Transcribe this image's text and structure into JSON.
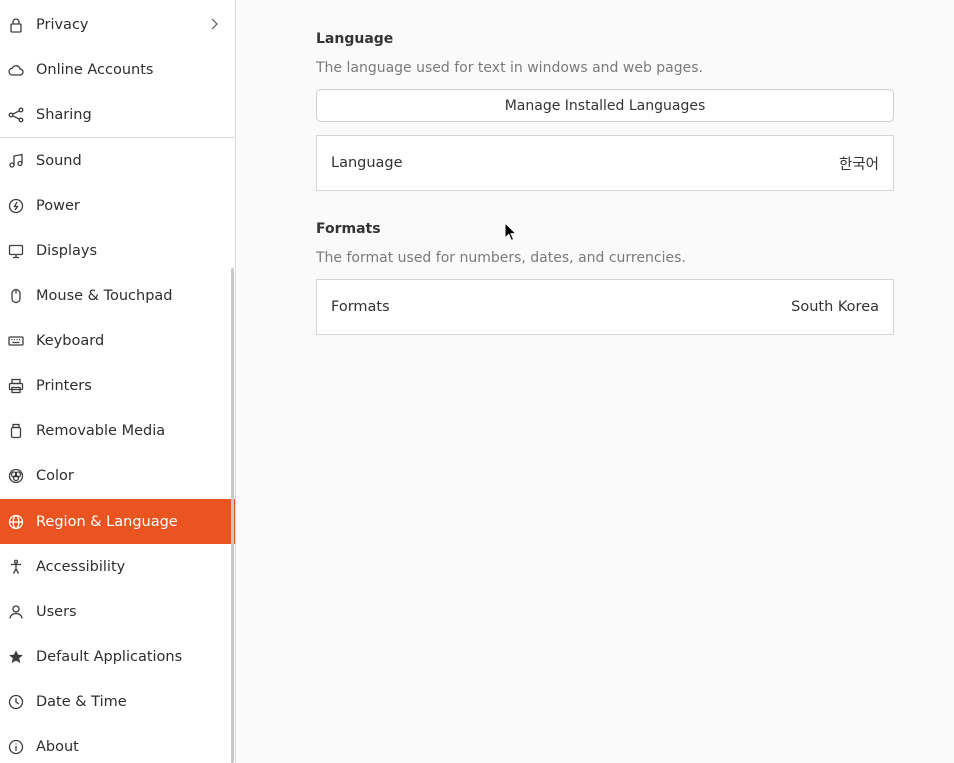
{
  "sidebar": {
    "items": [
      {
        "label": "Privacy",
        "icon": "lock-icon",
        "has_chevron": true
      },
      {
        "label": "Online Accounts",
        "icon": "cloud-icon"
      },
      {
        "label": "Sharing",
        "icon": "share-icon"
      },
      {
        "label": "Sound",
        "icon": "music-note-icon"
      },
      {
        "label": "Power",
        "icon": "power-icon"
      },
      {
        "label": "Displays",
        "icon": "display-icon"
      },
      {
        "label": "Mouse & Touchpad",
        "icon": "mouse-icon"
      },
      {
        "label": "Keyboard",
        "icon": "keyboard-icon"
      },
      {
        "label": "Printers",
        "icon": "printer-icon"
      },
      {
        "label": "Removable Media",
        "icon": "usb-drive-icon"
      },
      {
        "label": "Color",
        "icon": "color-icon"
      },
      {
        "label": "Region & Language",
        "icon": "globe-icon",
        "active": true
      },
      {
        "label": "Accessibility",
        "icon": "accessibility-icon"
      },
      {
        "label": "Users",
        "icon": "user-icon"
      },
      {
        "label": "Default Applications",
        "icon": "star-icon"
      },
      {
        "label": "Date & Time",
        "icon": "clock-icon"
      },
      {
        "label": "About",
        "icon": "info-icon"
      }
    ]
  },
  "main": {
    "language": {
      "title": "Language",
      "description": "The language used for text in windows and web pages.",
      "manage_button": "Manage Installed Languages",
      "row_label": "Language",
      "row_value": "한국어"
    },
    "formats": {
      "title": "Formats",
      "description": "The format used for numbers, dates, and currencies.",
      "row_label": "Formats",
      "row_value": "South Korea"
    }
  },
  "colors": {
    "accent": "#e95420"
  }
}
